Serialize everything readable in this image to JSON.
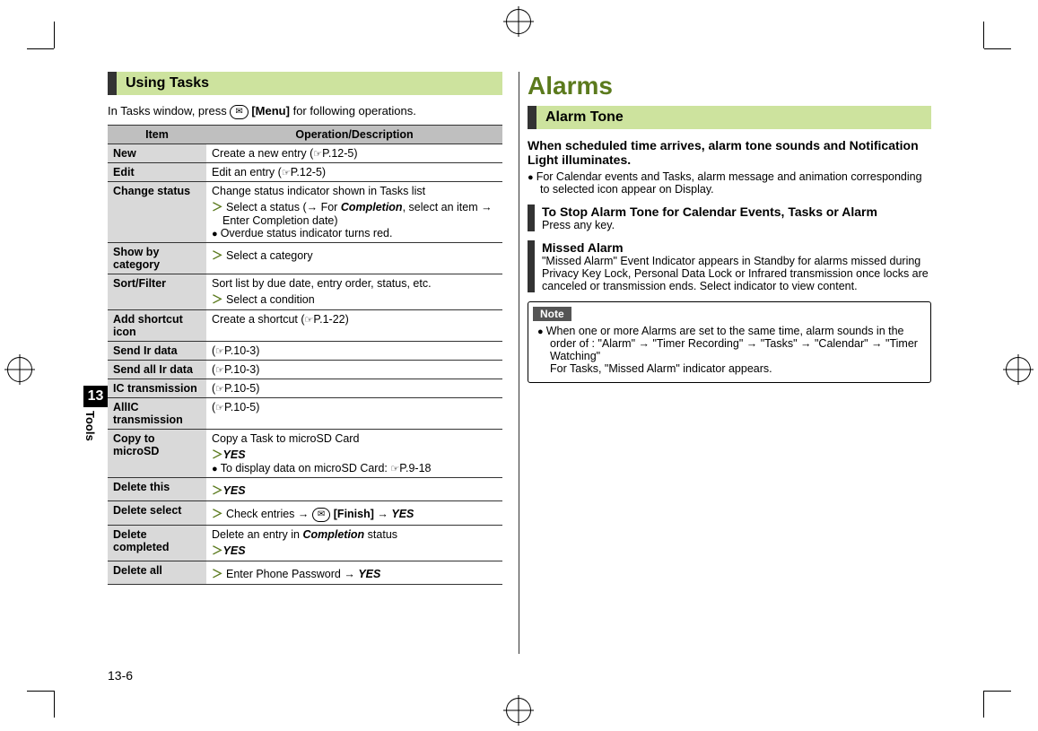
{
  "page_number": "13-6",
  "tab": {
    "chapter": "13",
    "label": "Tools"
  },
  "left": {
    "section_title": "Using Tasks",
    "intro_prefix": "In Tasks window, press ",
    "intro_key": "✉",
    "intro_key_label": "[Menu]",
    "intro_suffix": " for following operations.",
    "table": {
      "head_item": "Item",
      "head_desc": "Operation/Description",
      "rows": [
        {
          "item": "New",
          "desc_pre": "Create a new entry (",
          "ref": "P.12-5",
          "desc_post": ")"
        },
        {
          "item": "Edit",
          "desc_pre": "Edit an entry (",
          "ref": "P.12-5",
          "desc_post": ")"
        },
        {
          "item": "Change status",
          "line1": "Change status indicator shown in Tasks list",
          "chev_pre": "Select a status (",
          "chev_arrow1": "→",
          "chev_mid1": " For ",
          "chev_bold": "Completion",
          "chev_mid2": ", select an item ",
          "chev_arrow2": "→",
          "chev_sub": "Enter Completion date)",
          "bullet": "Overdue status indicator turns red."
        },
        {
          "item": "Show by category",
          "chev": "Select a category"
        },
        {
          "item": "Sort/Filter",
          "line1": "Sort list by due date, entry order, status, etc.",
          "chev": "Select a condition"
        },
        {
          "item": "Add shortcut icon",
          "desc_pre": "Create a shortcut (",
          "ref": "P.1-22",
          "desc_post": ")"
        },
        {
          "item": "Send Ir data",
          "desc_pre": "(",
          "ref": "P.10-3",
          "desc_post": ")"
        },
        {
          "item": "Send all Ir data",
          "desc_pre": "(",
          "ref": "P.10-3",
          "desc_post": ")"
        },
        {
          "item": "IC transmission",
          "desc_pre": "(",
          "ref": "P.10-5",
          "desc_post": ")"
        },
        {
          "item": "AllIC transmission",
          "desc_pre": "(",
          "ref": "P.10-5",
          "desc_post": ")"
        },
        {
          "item": "Copy to microSD",
          "line1": "Copy a Task to microSD Card",
          "chev_yes": "YES",
          "bullet_pre": "To display data on microSD Card: ",
          "bullet_ref": "P.9-18"
        },
        {
          "item": "Delete this",
          "chev_yes": "YES"
        },
        {
          "item": "Delete select",
          "chev_text": "Check entries ",
          "arrow1": "→",
          "key": "✉",
          "key_label": "[Finish]",
          "arrow2": "→",
          "yes": "YES"
        },
        {
          "item": "Delete completed",
          "line1_pre": "Delete an entry in ",
          "line1_bold": "Completion",
          "line1_post": " status",
          "chev_yes": "YES"
        },
        {
          "item": "Delete all",
          "chev_text": "Enter Phone Password ",
          "arrow": "→",
          "yes": "YES"
        }
      ]
    }
  },
  "right": {
    "heading": "Alarms",
    "section_title": "Alarm Tone",
    "lead": "When scheduled time arrives, alarm tone sounds and Notification Light illuminates.",
    "lead_bullet": "For Calendar events and Tasks, alarm message and animation corresponding to selected icon appear on Display.",
    "sub1_title": "To Stop Alarm Tone for Calendar Events, Tasks or Alarm",
    "sub1_body": "Press any key.",
    "sub2_title": "Missed Alarm",
    "sub2_body": "\"Missed Alarm\" Event Indicator appears in Standby for alarms missed during Privacy Key Lock, Personal Data Lock or Infrared transmission once locks are canceled or transmission ends. Select indicator to view content.",
    "note_label": "Note",
    "note_line1": "When one or more Alarms are set to the same time, alarm sounds in the order of : \"Alarm\" → \"Timer Recording\" → \"Tasks\" → \"Calendar\" → \"Timer Watching\"",
    "note_line2": "For Tasks, \"Missed Alarm\" indicator appears."
  }
}
